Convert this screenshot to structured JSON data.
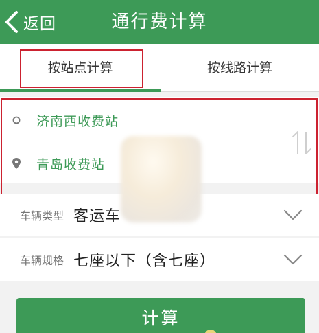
{
  "header": {
    "back_label": "返回",
    "title": "通行费计算"
  },
  "tabs": [
    {
      "label": "按站点计算",
      "active": true
    },
    {
      "label": "按线路计算",
      "active": false
    }
  ],
  "stations": {
    "origin": "济南西收费站",
    "destination": "青岛收费站"
  },
  "fields": [
    {
      "label": "车辆类型",
      "value": "客运车"
    },
    {
      "label": "车辆规格",
      "value": "七座以下（含七座）"
    }
  ],
  "action": {
    "calculate_label": "计算"
  },
  "colors": {
    "brand": "#3d9a57",
    "highlight": "#cc2230"
  }
}
